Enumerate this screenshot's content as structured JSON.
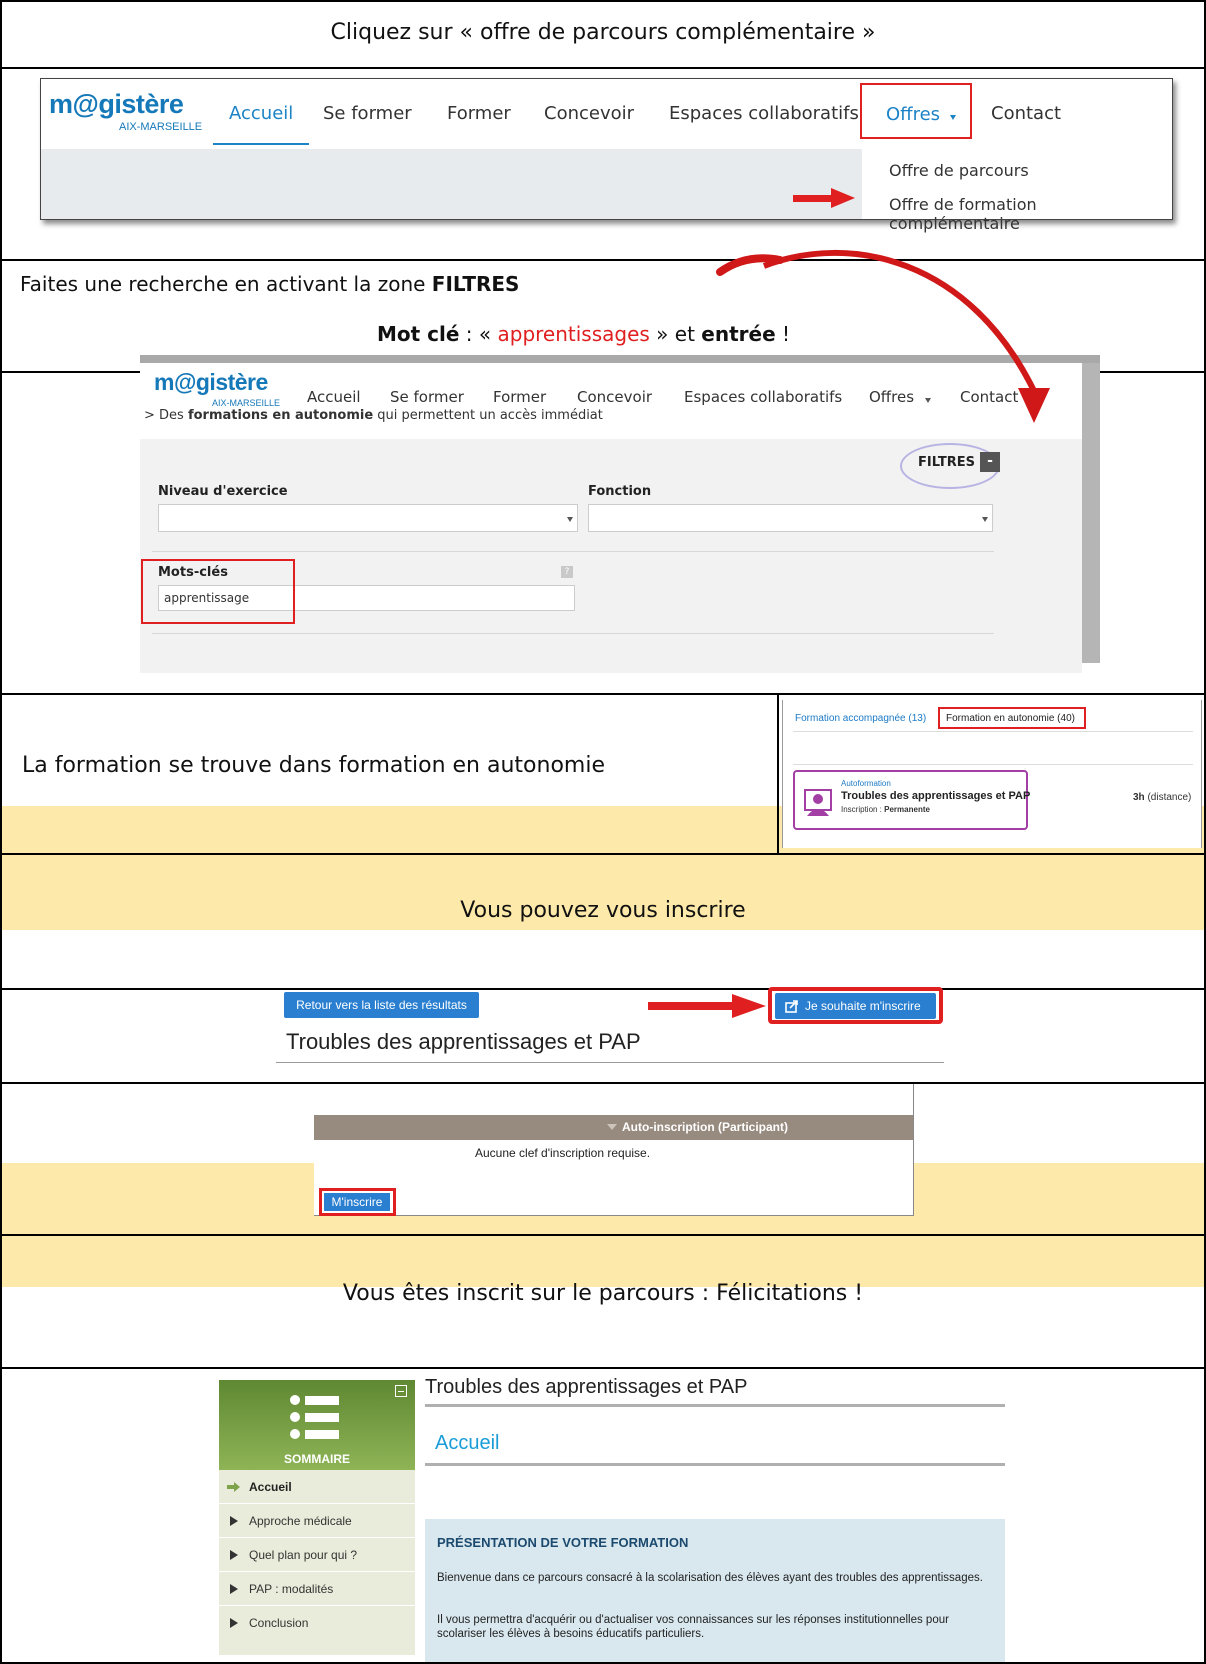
{
  "step1": {
    "instruction": "Cliquez sur « offre de parcours complémentaire »",
    "logo_main": "m@gistère",
    "logo_sub": "AIX-MARSEILLE",
    "nav": [
      "Accueil",
      "Se former",
      "Former",
      "Concevoir",
      "Espaces collaboratifs",
      "Offres",
      "Contact"
    ],
    "dropdown": [
      "Offre de parcours",
      "Offre de formation complémentaire"
    ]
  },
  "step2": {
    "instruction_prefix": "Faites une recherche en activant la zone ",
    "instruction_bold": "FILTRES",
    "keyword_label": "Mot clé",
    "keyword_sep": " : « ",
    "keyword_value": "apprentissages",
    "keyword_mid": " » et ",
    "keyword_enter": "entrée",
    "keyword_end": " !",
    "intro_prefix": "> Des ",
    "intro_bold": "formations en autonomie",
    "intro_rest": " qui permettent un accès immédiat",
    "filters_label": "FILTRES",
    "filters_toggle": "-",
    "niveau_label": "Niveau d'exercice",
    "fonction_label": "Fonction",
    "motscles_label": "Mots-clés",
    "motscles_value": "apprentissage",
    "help_glyph": "?"
  },
  "step3": {
    "text": "La formation se trouve dans formation en autonomie",
    "tab_accompagnee": "Formation accompagnée (13)",
    "tab_autonomie": "Formation en autonomie (40)",
    "card_type": "Autoformation",
    "card_title": "Troubles des apprentissages et PAP",
    "card_inscription_label": "Inscription : ",
    "card_inscription_value": "Permanente",
    "card_duration_bold": "3h",
    "card_duration_rest": " (distance)"
  },
  "step4": {
    "text": "Vous pouvez vous inscrire"
  },
  "step5": {
    "back_button": "Retour vers la liste des résultats",
    "subscribe_button": "Je souhaite m'inscrire",
    "course_title": "Troubles des apprentissages et PAP"
  },
  "step6": {
    "header": "Auto-inscription (Participant)",
    "no_key": "Aucune clef d'inscription requise.",
    "button": "M'inscrire"
  },
  "step7": {
    "text": "Vous êtes inscrit sur le parcours : Félicitations !"
  },
  "step8": {
    "sommaire_label": "SOMMAIRE",
    "menu": [
      "Accueil",
      "Approche médicale",
      "Quel plan pour qui ?",
      "PAP : modalités",
      "Conclusion"
    ],
    "course_title": "Troubles des apprentissages et PAP",
    "section_title": "Accueil",
    "presentation_title": "PRÉSENTATION DE VOTRE FORMATION",
    "paragraph1": "Bienvenue dans ce parcours consacré à la scolarisation des élèves ayant des troubles des apprentissages.",
    "paragraph2": "Il vous permettra d'acquérir ou d'actualiser vos connaissances sur les réponses institutionnelles pour scolariser les élèves à besoins éducatifs particuliers."
  },
  "colors": {
    "magistere_blue": "#1578b8",
    "highlight_red": "#e02020",
    "yellow_band": "#fde9a9",
    "sommaire_green": "#7ea34b",
    "accent_purple": "#a33ea5"
  }
}
